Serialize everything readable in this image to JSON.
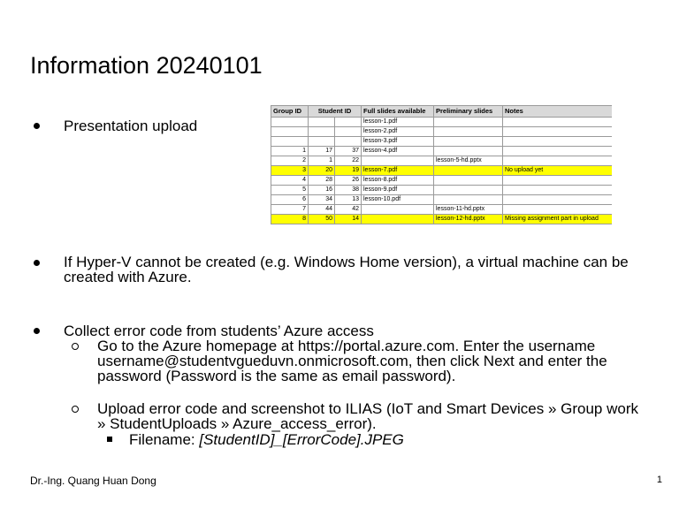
{
  "slide": {
    "title": "Information 20240101",
    "bullets": [
      {
        "text": "Presentation upload"
      },
      {
        "text": "If Hyper-V cannot be created (e.g. Windows Home version), a virtual machine can be created with Azure."
      },
      {
        "text": "Collect error code from students’ Azure access",
        "sub": [
          {
            "text": "Go to the Azure homepage at https://portal.azure.com. Enter the username username@studentvgueduvn.onmicrosoft.com, then click Next and enter the password (Password is the same as email password)."
          },
          {
            "text": "Upload error code and screenshot to ILIAS (IoT and Smart Devices » Group work » StudentUploads » Azure_access_error).",
            "sub": [
              {
                "label": "Filename: ",
                "value": "[StudentID]_[ErrorCode].JPEG"
              }
            ]
          }
        ]
      }
    ],
    "footer": {
      "author": "Dr.-Ing. Quang Huan Dong",
      "page": "1"
    }
  },
  "upload_table": {
    "headers": [
      "Group ID",
      "Student ID",
      "",
      "Full slides available",
      "Preliminary slides",
      "Notes"
    ],
    "rows": [
      [
        "",
        "",
        "",
        "lesson-1.pdf",
        "",
        ""
      ],
      [
        "",
        "",
        "",
        "lesson-2.pdf",
        "",
        ""
      ],
      [
        "",
        "",
        "",
        "lesson-3.pdf",
        "",
        ""
      ],
      [
        "1",
        "17",
        "37",
        "lesson-4.pdf",
        "",
        ""
      ],
      [
        "2",
        "1",
        "22",
        "",
        "lesson-5-hd.pptx",
        ""
      ],
      [
        "3",
        "20",
        "19",
        "lesson-7.pdf",
        "",
        "No upload yet"
      ],
      [
        "4",
        "28",
        "26",
        "lesson-8.pdf",
        "",
        ""
      ],
      [
        "5",
        "16",
        "38",
        "lesson-9.pdf",
        "",
        ""
      ],
      [
        "6",
        "34",
        "13",
        "lesson-10.pdf",
        "",
        ""
      ],
      [
        "7",
        "44",
        "42",
        "",
        "lesson-11-hd.pptx",
        ""
      ],
      [
        "8",
        "50",
        "14",
        "",
        "lesson-12-hd.pptx",
        "Missing assignment part in upload"
      ]
    ],
    "highlight_color": "#ffff00",
    "highlighted_rows": [
      5,
      10
    ]
  }
}
